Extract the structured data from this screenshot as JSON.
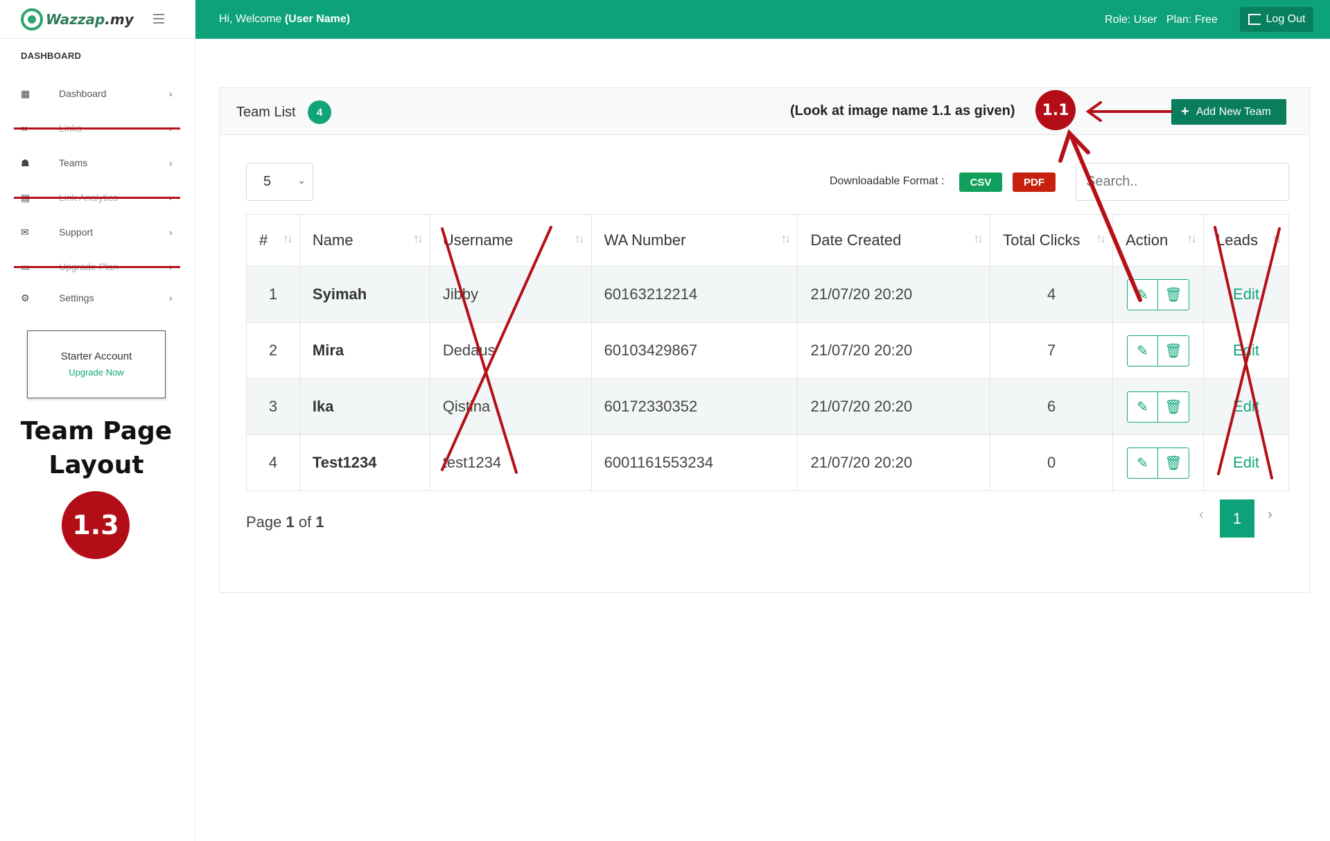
{
  "brand": {
    "name_part1": "Wazzap",
    "name_part2": ".my"
  },
  "sidebar": {
    "heading": "DASHBOARD",
    "items": [
      {
        "label": "Dashboard",
        "icon": "grid-icon",
        "struck": false
      },
      {
        "label": "Links",
        "icon": "link-icon",
        "struck": true
      },
      {
        "label": "Teams",
        "icon": "users-icon",
        "struck": false
      },
      {
        "label": "Link Analytics",
        "icon": "chart-icon",
        "struck": true
      },
      {
        "label": "Support",
        "icon": "envelope-icon",
        "struck": false
      },
      {
        "label": "Upgrade Plan",
        "icon": "card-icon",
        "struck": true
      },
      {
        "label": "Settings",
        "icon": "gear-icon",
        "struck": false
      }
    ],
    "starter": {
      "title": "Starter Account",
      "link": "Upgrade Now"
    }
  },
  "annotation": {
    "page_title_line1": "Team Page",
    "page_title_line2": "Layout",
    "badge_page": "1.3",
    "badge_ref": "1.1",
    "look_note": "(Look at image name 1.1 as given)"
  },
  "topbar": {
    "welcome_prefix": "Hi, Welcome ",
    "welcome_user": "(User Name)",
    "role": "Role: User",
    "plan": "Plan: Free",
    "logout": "Log Out"
  },
  "card": {
    "title": "Team List",
    "count": "4",
    "add_button": "Add New Team",
    "page_size": "5",
    "download_label": "Downloadable Format :",
    "csv": "CSV",
    "pdf": "PDF",
    "search_placeholder": "Search.."
  },
  "table": {
    "headers": [
      "#",
      "Name",
      "Username",
      "WA Number",
      "Date Created",
      "Total Clicks",
      "Action",
      "Leads"
    ],
    "rows": [
      {
        "no": "1",
        "name": "Syimah",
        "username": "Jibby",
        "wa": "60163212214",
        "date": "21/07/20 20:20",
        "clicks": "4",
        "leads": "Edit"
      },
      {
        "no": "2",
        "name": "Mira",
        "username": "Dedaus",
        "wa": "60103429867",
        "date": "21/07/20 20:20",
        "clicks": "7",
        "leads": "Edit"
      },
      {
        "no": "3",
        "name": "Ika",
        "username": "Qistina",
        "wa": "60172330352",
        "date": "21/07/20 20:20",
        "clicks": "6",
        "leads": "Edit"
      },
      {
        "no": "4",
        "name": "Test1234",
        "username": "test1234",
        "wa": "6001161553234",
        "date": "21/07/20 20:20",
        "clicks": "0",
        "leads": "Edit"
      }
    ]
  },
  "pager": {
    "prefix": "Page ",
    "current": "1",
    "of": " of ",
    "total": "1",
    "button": "1"
  },
  "colors": {
    "accent": "#0ea27a",
    "annotation_red": "#b30d17"
  }
}
